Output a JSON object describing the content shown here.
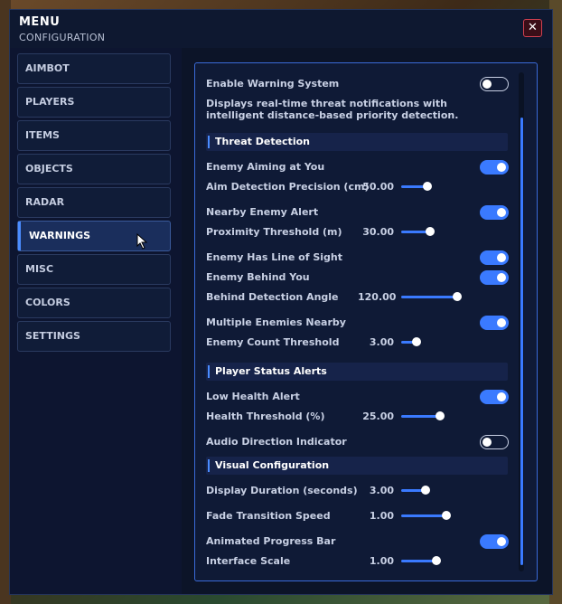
{
  "header": {
    "title": "MENU",
    "subtitle": "CONFIGURATION",
    "close_label": "✕"
  },
  "sidebar": {
    "items": [
      {
        "label": "AIMBOT"
      },
      {
        "label": "PLAYERS"
      },
      {
        "label": "ITEMS"
      },
      {
        "label": "OBJECTS"
      },
      {
        "label": "RADAR"
      },
      {
        "label": "WARNINGS",
        "active": true
      },
      {
        "label": "MISC"
      },
      {
        "label": "COLORS"
      },
      {
        "label": "SETTINGS"
      }
    ]
  },
  "panel": {
    "enable": {
      "label": "Enable Warning System",
      "on": false
    },
    "description": "Displays real-time threat notifications with intelligent distance-based priority detection.",
    "sections": {
      "threat": "Threat Detection",
      "player": "Player Status Alerts",
      "visual": "Visual Configuration"
    },
    "enemy_aiming": {
      "label": "Enemy Aiming at You",
      "on": true
    },
    "aim_precision": {
      "label": "Aim Detection Precision (cm)",
      "value": "50.00",
      "fraction": 0.38
    },
    "nearby_alert": {
      "label": "Nearby Enemy Alert",
      "on": true
    },
    "proximity": {
      "label": "Proximity Threshold (m)",
      "value": "30.00",
      "fraction": 0.44
    },
    "line_of_sight": {
      "label": "Enemy Has Line of Sight",
      "on": true
    },
    "behind_you": {
      "label": "Enemy Behind You",
      "on": true
    },
    "behind_angle": {
      "label": "Behind Detection Angle",
      "value": "120.00",
      "fraction": 0.92
    },
    "multiple_enemies": {
      "label": "Multiple Enemies Nearby",
      "on": true
    },
    "enemy_count": {
      "label": "Enemy Count Threshold",
      "value": "3.00",
      "fraction": 0.2
    },
    "low_health": {
      "label": "Low Health Alert",
      "on": true
    },
    "health_threshold": {
      "label": "Health Threshold (%)",
      "value": "25.00",
      "fraction": 0.62
    },
    "audio_direction": {
      "label": "Audio Direction Indicator",
      "on": false
    },
    "display_duration": {
      "label": "Display Duration (seconds)",
      "value": "3.00",
      "fraction": 0.35
    },
    "fade_speed": {
      "label": "Fade Transition Speed",
      "value": "1.00",
      "fraction": 0.73
    },
    "progress_bar": {
      "label": "Animated Progress Bar",
      "on": true
    },
    "interface_scale": {
      "label": "Interface Scale",
      "value": "1.00",
      "fraction": 0.55
    }
  },
  "colors": {
    "accent": "#3a7aff",
    "panel_bg": "#0f1a36",
    "close_border": "#d04050"
  }
}
